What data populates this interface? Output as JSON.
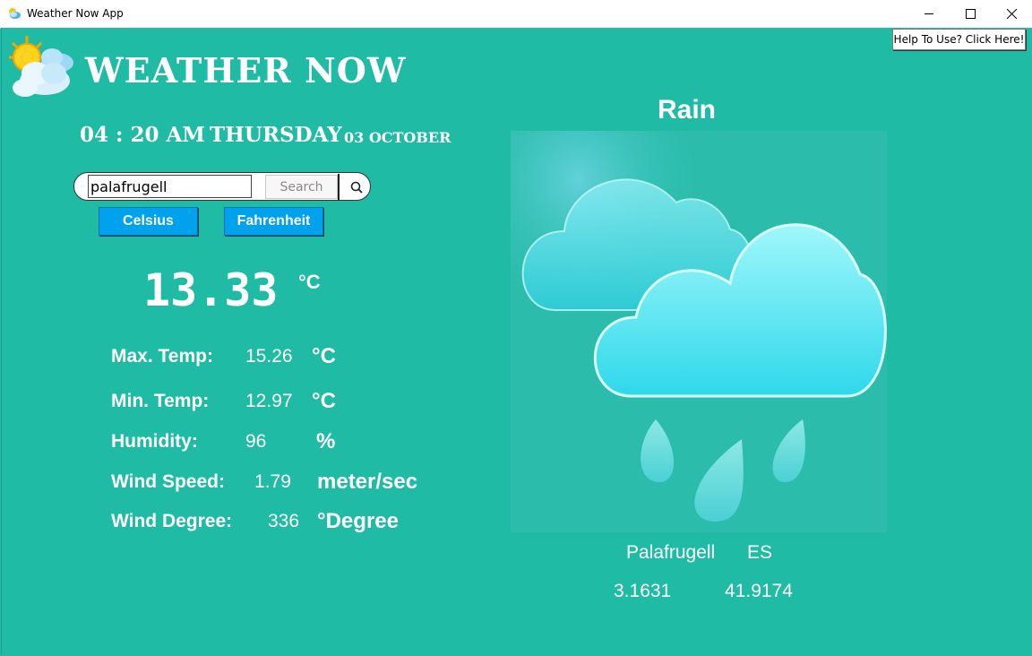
{
  "window": {
    "title": "Weather Now App",
    "controls": [
      "minimize",
      "maximize",
      "close"
    ]
  },
  "help_button": "Help To Use? Click Here!",
  "app": {
    "heading": "WEATHER NOW"
  },
  "datetime": {
    "time": "04 : 20 AM",
    "day": "THURSDAY",
    "date": "03 OCTOBER"
  },
  "search": {
    "value": "palafrugell",
    "button": "Search",
    "icon": "search-icon"
  },
  "units": {
    "celsius": "Celsius",
    "fahrenheit": "Fahrenheit"
  },
  "current": {
    "temperature": "13.33",
    "unit": "°C"
  },
  "details": [
    {
      "label": "Max. Temp:",
      "value": "15.26",
      "unit": "°C"
    },
    {
      "label": "Min. Temp:",
      "value": "12.97",
      "unit": "°C"
    },
    {
      "label": "Humidity:",
      "value": "96",
      "unit": "%"
    },
    {
      "label": "Wind Speed:",
      "value": "1.79",
      "unit": "meter/sec"
    },
    {
      "label": "Wind Degree:",
      "value": "336",
      "unit": "°Degree"
    }
  ],
  "condition": {
    "text": "Rain",
    "icon": "rain-cloud-icon"
  },
  "location": {
    "city": "Palafrugell",
    "country": "ES",
    "lon": "3.1631",
    "lat": "41.9174"
  },
  "colors": {
    "background": "#20bba5",
    "button_blue": "#00a2ed",
    "text": "#ffffff"
  }
}
